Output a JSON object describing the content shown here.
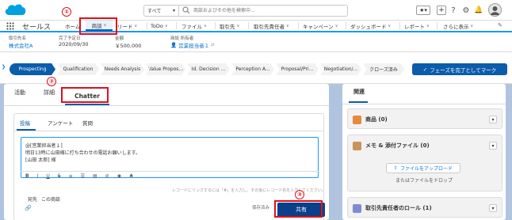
{
  "header": {
    "search_scope": "すべて",
    "search_placeholder": "商談およびその他を検索中..."
  },
  "nav": {
    "app_name": "セールス",
    "items": [
      {
        "label": "ホーム",
        "dropdown": false
      },
      {
        "label": "商談",
        "dropdown": true
      },
      {
        "label": "リード",
        "dropdown": true
      },
      {
        "label": "ToDo",
        "dropdown": true
      },
      {
        "label": "ファイル",
        "dropdown": true
      },
      {
        "label": "取引先",
        "dropdown": true
      },
      {
        "label": "取引先責任者",
        "dropdown": true
      },
      {
        "label": "キャンペーン",
        "dropdown": true
      },
      {
        "label": "ダッシュボード",
        "dropdown": true
      },
      {
        "label": "レポート",
        "dropdown": true
      },
      {
        "label": "さらに表示",
        "dropdown": true
      }
    ]
  },
  "record": {
    "fields": [
      {
        "label": "取引先名",
        "value": "株式会社A"
      },
      {
        "label": "完了予定日",
        "value": "2020/09/30"
      },
      {
        "label": "金額",
        "value": "￥500,000"
      },
      {
        "label": "商談 所有者",
        "value": "営業担当者１"
      }
    ]
  },
  "path": {
    "stages": [
      "Prospecting",
      "Qualification",
      "Needs Analysis",
      "Value Propos...",
      "Id. Decision ...",
      "Perception A...",
      "Proposal/Pri...",
      "Negotiation/...",
      "クローズ済み"
    ],
    "mark_button": "フェーズを完了としてマーク"
  },
  "left": {
    "tabs": [
      "活動",
      "詳細",
      "Chatter"
    ],
    "composer_tabs": [
      "投稿",
      "アンケート",
      "質問"
    ],
    "post_lines": [
      "@[営業担当者１]",
      "明日13時に山田様に打ち合わせの電話お願いします。",
      "[山田 太郎] 様"
    ],
    "toolbar_icons": [
      "B",
      "I",
      "U",
      "S",
      "≡",
      "☰",
      "▤",
      "⊘",
      "◉",
      "♣"
    ],
    "hint": "レコードにリンクするには「#」を入力し、その後にレコード名を入力してください。",
    "to_label": "宛先",
    "to_value": "この商談",
    "follow_label": "保存済み",
    "share_button": "共有"
  },
  "right": {
    "header": "関連",
    "cards": [
      {
        "title": "商品 (0)",
        "color": "#e68a3c"
      },
      {
        "title": "メモ & 添付ファイル (0)",
        "color": "#c8945b"
      },
      {
        "title": "取引先責任者のロール (1)",
        "color": "#7e8bd1"
      }
    ],
    "upload_button": "ファイルをアップロード",
    "drop_text": "またはファイルをドロップ"
  },
  "annotations": [
    "①",
    "②",
    "③"
  ],
  "colors": {
    "brand_blue": "#0b5cab",
    "annotation_red": "#e0101a"
  }
}
